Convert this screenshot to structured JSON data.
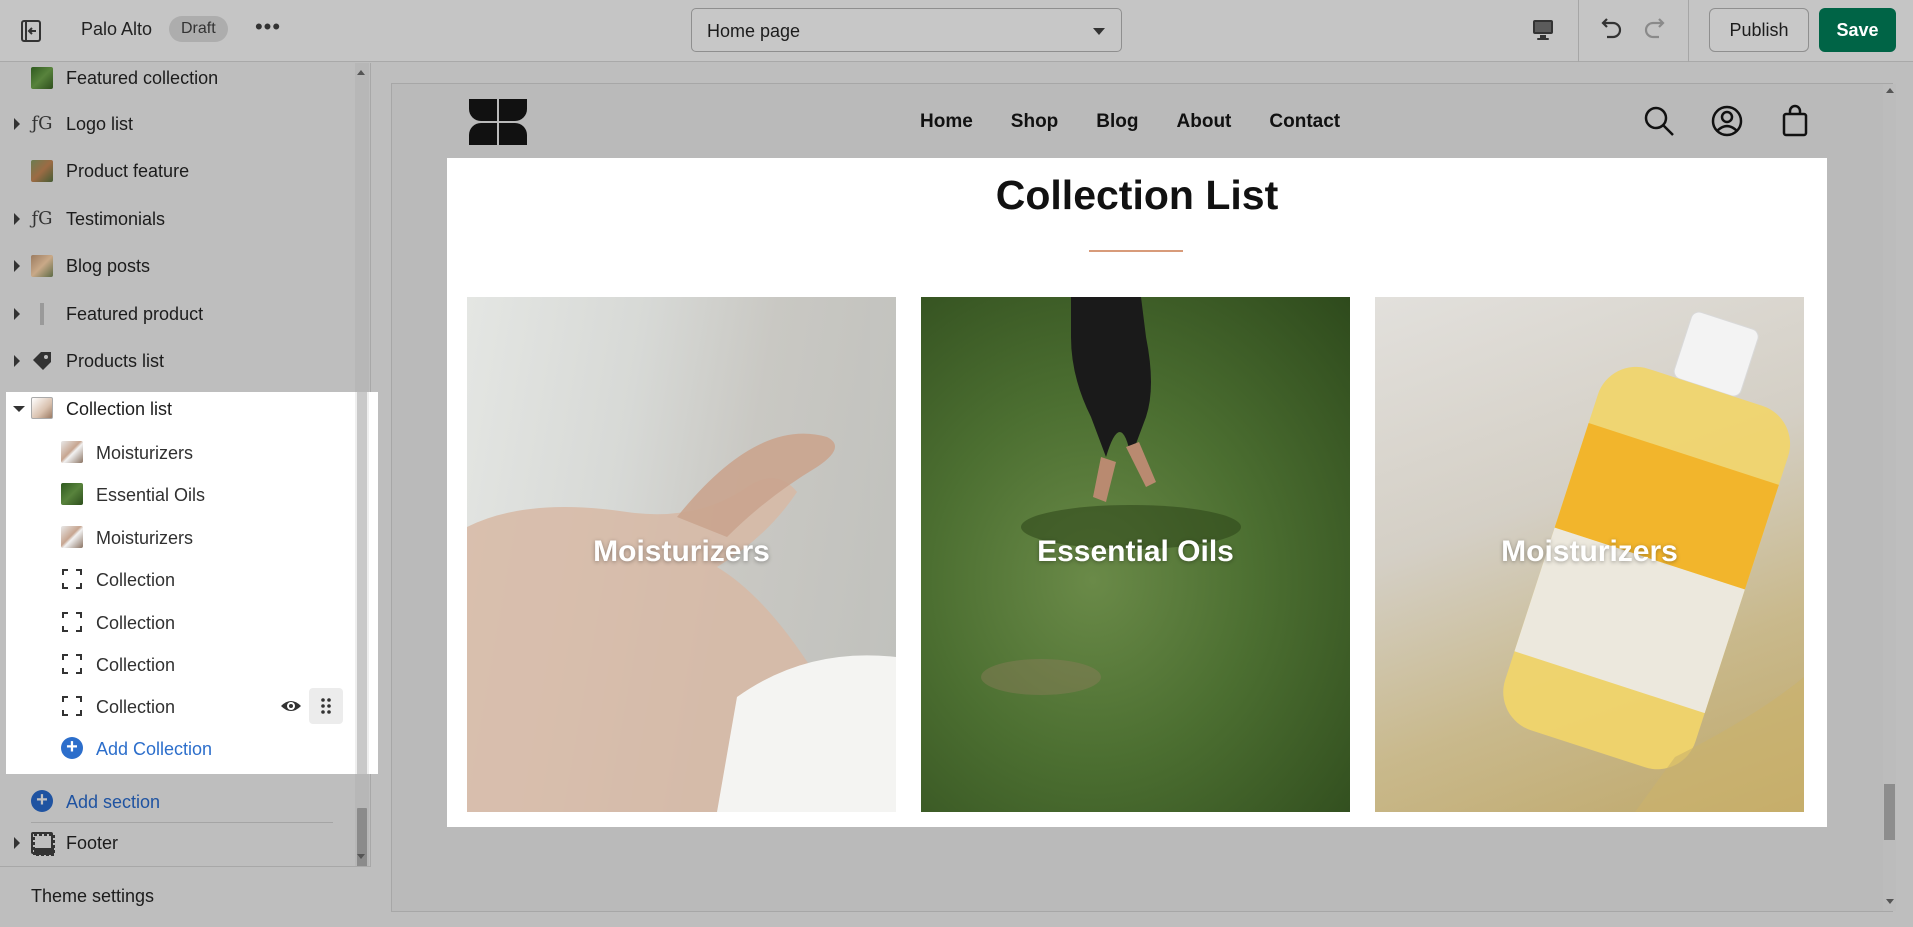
{
  "topbar": {
    "store_name": "Palo Alto",
    "status_badge": "Draft",
    "more_label": "•••",
    "page_select": "Home page",
    "publish_label": "Publish",
    "save_label": "Save"
  },
  "sidebar": {
    "sections": [
      {
        "label": "Featured collection",
        "expandable": false
      },
      {
        "label": "Logo list",
        "expandable": true
      },
      {
        "label": "Product feature",
        "expandable": false
      },
      {
        "label": "Testimonials",
        "expandable": true
      },
      {
        "label": "Blog posts",
        "expandable": true
      },
      {
        "label": "Featured product",
        "expandable": true
      },
      {
        "label": "Products list",
        "expandable": true
      }
    ],
    "active_section": {
      "label": "Collection list",
      "blocks": [
        {
          "label": "Moisturizers",
          "thumb": "hands"
        },
        {
          "label": "Essential Oils",
          "thumb": "grass"
        },
        {
          "label": "Moisturizers",
          "thumb": "hands"
        },
        {
          "label": "Collection",
          "thumb": "placeholder"
        },
        {
          "label": "Collection",
          "thumb": "placeholder"
        },
        {
          "label": "Collection",
          "thumb": "placeholder"
        },
        {
          "label": "Collection",
          "thumb": "placeholder"
        }
      ],
      "add_block_label": "Add Collection"
    },
    "add_section_label": "Add section",
    "footer_label": "Footer",
    "theme_settings_label": "Theme settings"
  },
  "preview": {
    "nav": [
      "Home",
      "Shop",
      "Blog",
      "About",
      "Contact"
    ],
    "section_title": "Collection List",
    "cards": [
      {
        "caption": "Moisturizers"
      },
      {
        "caption": "Essential Oils"
      },
      {
        "caption": "Moisturizers"
      }
    ]
  },
  "colors": {
    "save_button": "#006446",
    "link_blue": "#2c6ecb",
    "title_rule": "#d89b7a"
  }
}
